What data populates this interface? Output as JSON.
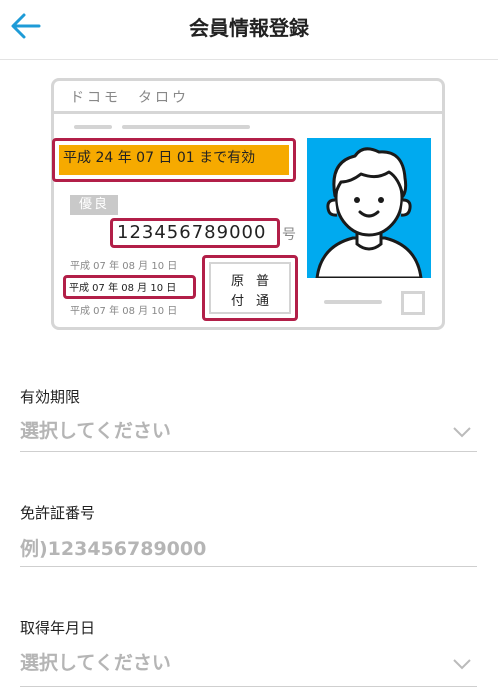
{
  "header": {
    "title": "会員情報登録"
  },
  "license": {
    "name": "ドコモ　タロウ",
    "expiry": "平成 24 年 07 日 01 まで有効",
    "badge": "優良",
    "number": "123456789000",
    "number_suffix": "号",
    "dates": [
      "平成 07 年 08 月 10 日",
      "平成 07 年 08 月 10 日",
      "平成 07 年 08 月 10 日"
    ],
    "categories": {
      "row1": "原普",
      "row2": "付通"
    }
  },
  "form": {
    "expiry": {
      "label": "有効期限",
      "placeholder": "選択してください"
    },
    "license_number": {
      "label": "免許証番号",
      "placeholder": "例)123456789000"
    },
    "acquired_date": {
      "label": "取得年月日",
      "placeholder": "選択してください"
    }
  },
  "colors": {
    "accent": "#1e9bd7",
    "highlight_border": "#b21f48",
    "expiry_band": "#f6aa00",
    "photo_bg": "#00aaef"
  }
}
